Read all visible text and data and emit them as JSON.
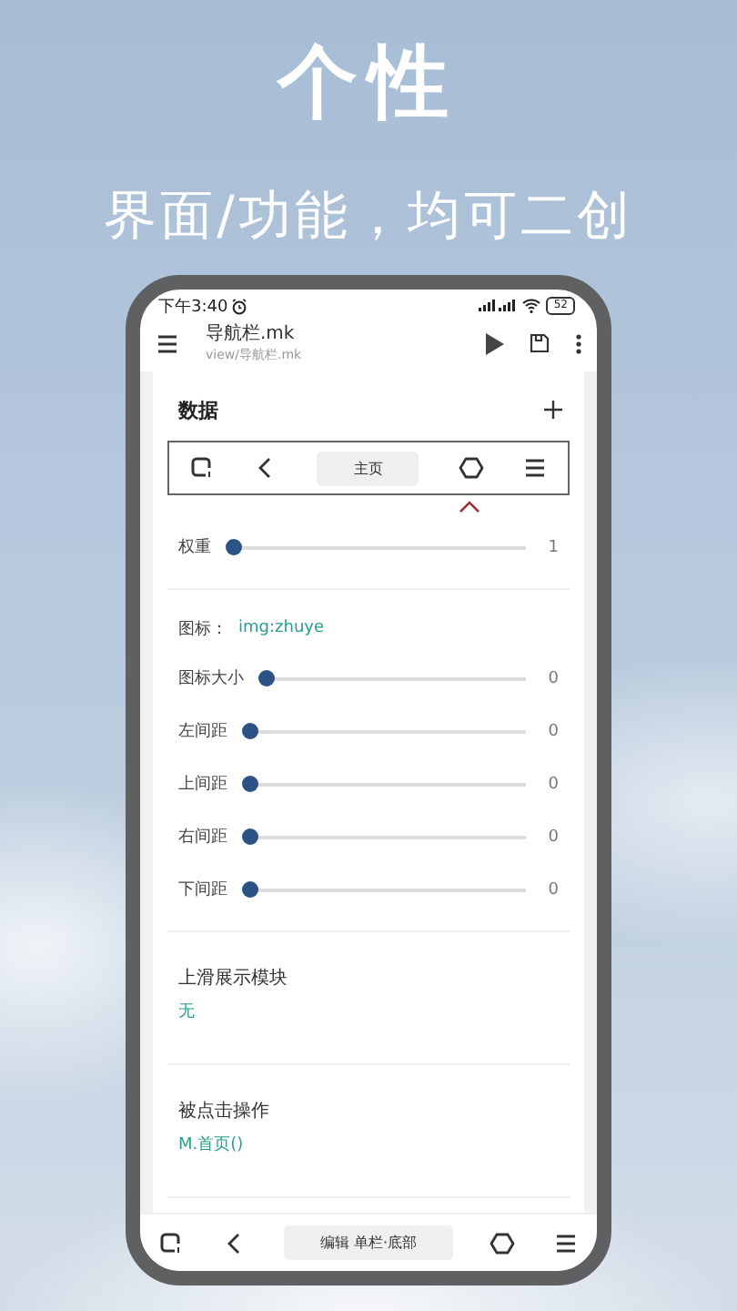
{
  "headline": "个性",
  "subheadline": "界面/功能，均可二创",
  "status_bar": {
    "time": "下午3:40",
    "battery": "52"
  },
  "app_bar": {
    "title": "导航栏.mk",
    "subtitle": "view/导航栏.mk"
  },
  "section": {
    "title": "数据",
    "preview_bar": [
      {
        "kind": "recents"
      },
      {
        "kind": "back"
      },
      {
        "kind": "label",
        "label": "主页"
      },
      {
        "kind": "home"
      },
      {
        "kind": "menu"
      }
    ],
    "weight": {
      "label": "权重",
      "level": 0,
      "reading": "1"
    },
    "icon_field": {
      "label": "图标：",
      "value": "img:zhuye"
    },
    "sliders": [
      {
        "label": "图标大小",
        "level": 0,
        "reading": "0"
      },
      {
        "label": "左间距",
        "level": 0,
        "reading": "0"
      },
      {
        "label": "上间距",
        "level": 0,
        "reading": "0"
      },
      {
        "label": "右间距",
        "level": 0,
        "reading": "0"
      },
      {
        "label": "下间距",
        "level": 0,
        "reading": "0"
      }
    ],
    "options": [
      {
        "label": "上滑展示模块",
        "value": "无"
      },
      {
        "label": "被点击操作",
        "value": "M.首页()"
      }
    ]
  },
  "bottom_nav": [
    {
      "kind": "recents"
    },
    {
      "kind": "back"
    },
    {
      "kind": "label",
      "label": "编辑 单栏·底部"
    },
    {
      "kind": "home"
    },
    {
      "kind": "menu"
    }
  ]
}
